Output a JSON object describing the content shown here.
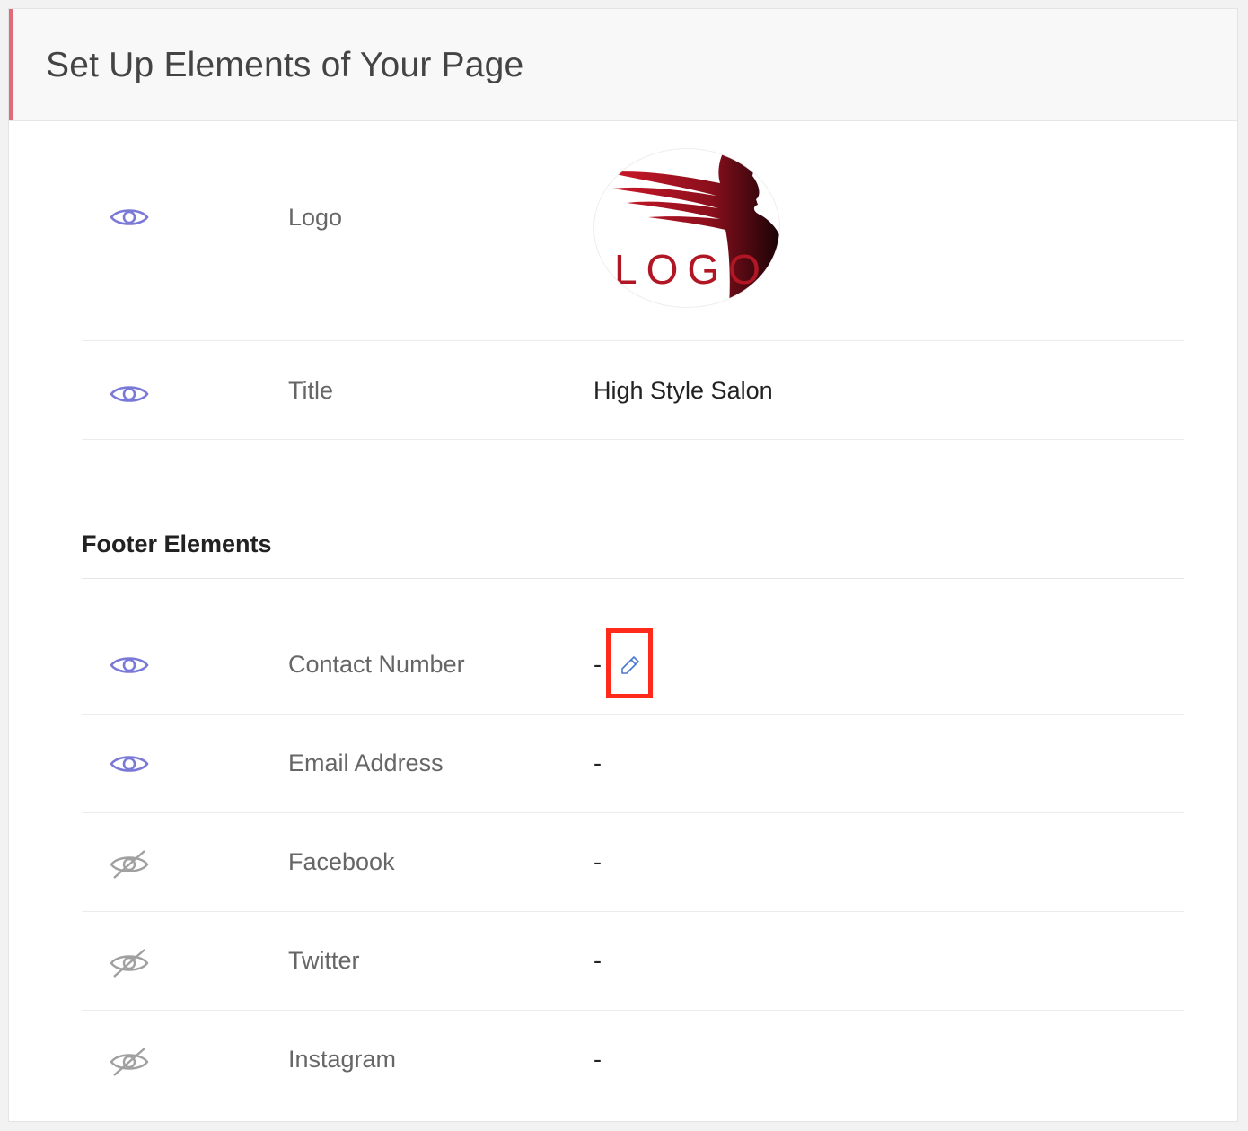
{
  "header": {
    "title": "Set Up Elements of Your Page",
    "accent_color": "#e06b78"
  },
  "elements": [
    {
      "label": "Logo",
      "visible": true,
      "icon": "eye-icon",
      "logo_text": "LOGO"
    },
    {
      "label": "Title",
      "visible": true,
      "icon": "eye-icon",
      "value": "High Style Salon"
    }
  ],
  "footer": {
    "section_title": "Footer Elements",
    "items": [
      {
        "label": "Contact Number",
        "visible": true,
        "icon": "eye-icon",
        "value": "-",
        "edit_icon": "pencil-icon"
      },
      {
        "label": "Email Address",
        "visible": true,
        "icon": "eye-icon",
        "value": "-"
      },
      {
        "label": "Facebook",
        "visible": false,
        "icon": "eye-off-icon",
        "value": "-"
      },
      {
        "label": "Twitter",
        "visible": false,
        "icon": "eye-off-icon",
        "value": "-"
      },
      {
        "label": "Instagram",
        "visible": false,
        "icon": "eye-off-icon",
        "value": "-"
      }
    ]
  },
  "colors": {
    "visible_icon": "#7b79d8",
    "hidden_icon": "#a0a0a0",
    "edit_icon": "#4a7ad0",
    "highlight_box": "#ff2a1a"
  }
}
